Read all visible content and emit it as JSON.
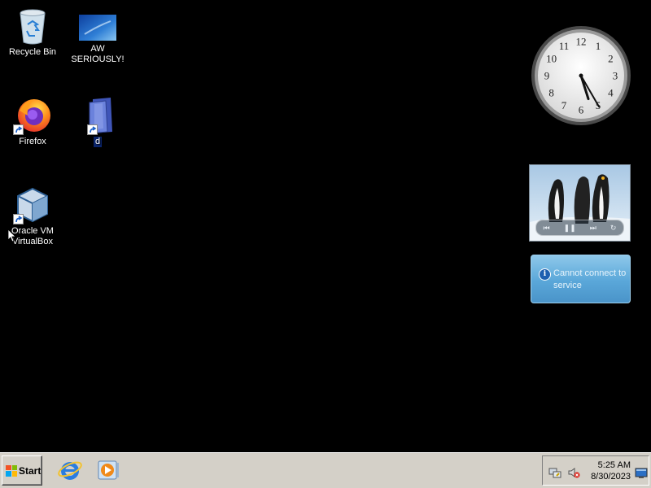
{
  "desktop": {
    "icons": [
      {
        "label": "Recycle Bin",
        "icon": "recycle-bin-icon"
      },
      {
        "label": "AW SERIOUSLY!",
        "icon": "image-file-icon"
      },
      {
        "label": "Firefox",
        "icon": "firefox-icon"
      },
      {
        "label": "d",
        "icon": "folder-icon"
      },
      {
        "label": "Oracle VM VirtualBox",
        "icon": "virtualbox-icon"
      }
    ],
    "background_color": "#000000"
  },
  "gadgets": {
    "clock": {
      "time": "5:25",
      "numerals": [
        "12",
        "1",
        "2",
        "3",
        "4",
        "5",
        "6",
        "7",
        "8",
        "9",
        "10",
        "11"
      ]
    },
    "slideshow": {
      "controls": [
        "previous-icon",
        "pause-icon",
        "next-icon",
        "repeat-icon"
      ]
    },
    "feed": {
      "message": "Cannot connect to service"
    }
  },
  "taskbar": {
    "start_label": "Start",
    "quick_launch": [
      "internet-explorer-icon",
      "media-player-icon"
    ],
    "tray": {
      "time": "5:25 AM",
      "date": "8/30/2023",
      "icons": [
        "network-icon",
        "volume-muted-icon",
        "show-desktop-icon"
      ]
    }
  }
}
